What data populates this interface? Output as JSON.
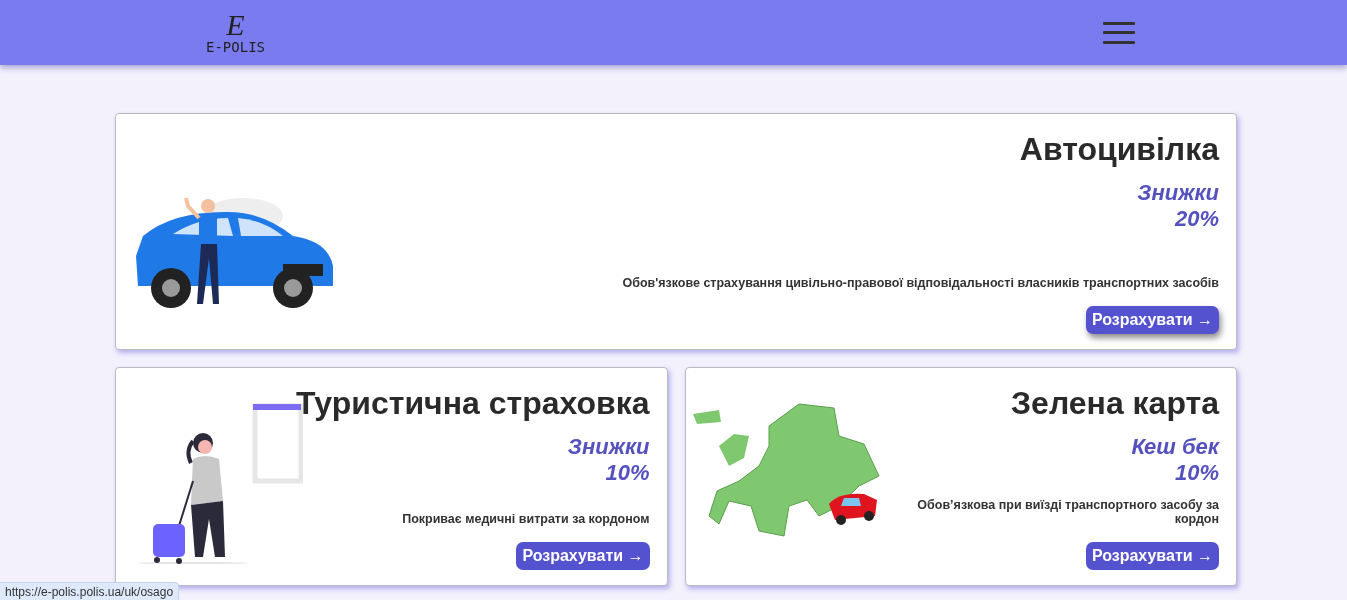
{
  "header": {
    "logo": {
      "mark": "E",
      "text": "E-POLIS"
    }
  },
  "cards": [
    {
      "kind": "car",
      "title": "Автоцивілка",
      "offer": "Знижки",
      "amount": "20%",
      "description": "Обов'язкове страхування цивільно-правової відповідальності власників транспортних засобів",
      "button": "Розрахувати →"
    },
    {
      "kind": "traveler",
      "title": "Туристична страховка",
      "offer": "Знижки",
      "amount": "10%",
      "description": "Покриває медичні витрати за кордоном",
      "button": "Розрахувати →"
    },
    {
      "kind": "map",
      "title": "Зелена карта",
      "offer": "Кеш бек",
      "amount": "10%",
      "description": "Обов’язкова при виїзді транспортного засобу за кордон",
      "button": "Розрахувати →"
    }
  ],
  "status_bar": {
    "url": "https://e-polis.polis.ua/uk/osago"
  }
}
